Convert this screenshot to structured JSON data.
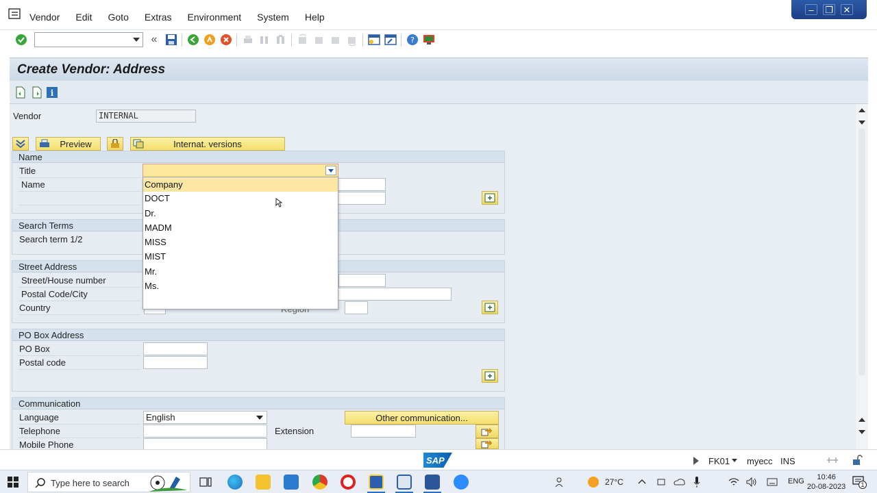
{
  "menu": [
    "Vendor",
    "Edit",
    "Goto",
    "Extras",
    "Environment",
    "System",
    "Help"
  ],
  "window_controls": {
    "minimize": "–",
    "restore": "❐",
    "close": "✕"
  },
  "screen": {
    "title": "Create Vendor: Address",
    "vendor_label": "Vendor",
    "vendor_value": "INTERNAL",
    "preview_button": "Preview",
    "intl_versions_button": "Internat. versions"
  },
  "groups": {
    "name": {
      "header": "Name",
      "title_label": "Title",
      "name_label": "Name"
    },
    "search_terms": {
      "header": "Search Terms",
      "search_term_label": "Search term 1/2"
    },
    "street_address": {
      "header": "Street Address",
      "street_label": "Street/House number",
      "postal_city_label": "Postal Code/City",
      "country_label": "Country",
      "region_label": "Region"
    },
    "po_box": {
      "header": "PO Box Address",
      "po_box_label": "PO Box",
      "postal_code_label": "Postal code"
    },
    "communication": {
      "header": "Communication",
      "language_label": "Language",
      "language_value": "English",
      "telephone_label": "Telephone",
      "extension_label": "Extension",
      "mobile_label": "Mobile Phone",
      "other_comm_button": "Other communication..."
    }
  },
  "title_dropdown": {
    "selected": "Company",
    "options": [
      "Company",
      "DOCT",
      "Dr.",
      "MADM",
      "MISS",
      "MIST",
      "Mr.",
      "Ms."
    ]
  },
  "statusbar": {
    "sap_logo": "SAP",
    "transaction": "FK01",
    "system": "myecc",
    "mode": "INS"
  },
  "taskbar": {
    "search_placeholder": "Type here to search",
    "temperature": "27°C",
    "language": "ENG",
    "time": "10:46",
    "date": "20-08-2023",
    "notification_count": "1"
  },
  "colors": {
    "title_band": "#cbd9e6",
    "group_header": "#d5e1ec",
    "button_yellow": "#f5df6c",
    "dropdown_selected": "#fbe7a3"
  }
}
